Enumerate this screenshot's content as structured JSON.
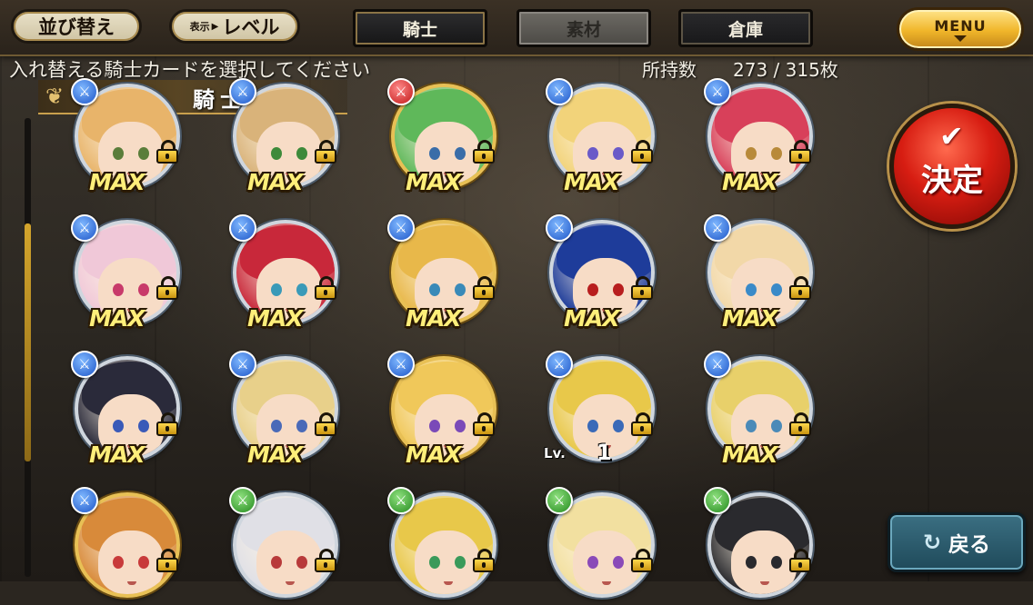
{
  "toolbar": {
    "sort_label": "並び替え",
    "display_prefix": "表示",
    "display_value": "レベル",
    "tabs": [
      {
        "label": "騎士",
        "state": "active"
      },
      {
        "label": "素材",
        "state": "inactive"
      },
      {
        "label": "倉庫",
        "state": "normal"
      }
    ],
    "menu_label": "MENU"
  },
  "instruction": "入れ替える騎士カードを選択してください",
  "owned": {
    "label": "所持数",
    "value": "273 / 315枚"
  },
  "section_title": "騎士",
  "cards": [
    {
      "attr": "blue",
      "label": "MAX",
      "hair": "#e8b46a",
      "eye": "#5a7d3a",
      "frame": "silver"
    },
    {
      "attr": "blue",
      "label": "MAX",
      "hair": "#d9b37a",
      "eye": "#3d8a3a",
      "frame": "silver"
    },
    {
      "attr": "red",
      "label": "MAX",
      "hair": "#5fb85a",
      "eye": "#3a6da8",
      "frame": "gold"
    },
    {
      "attr": "blue",
      "label": "MAX",
      "hair": "#f2d37a",
      "eye": "#6a5ac8",
      "frame": "silver"
    },
    {
      "attr": "blue",
      "label": "MAX",
      "hair": "#d8405a",
      "eye": "#b88a3a",
      "frame": "silver"
    },
    {
      "attr": "blue",
      "label": "MAX",
      "hair": "#f0c8d8",
      "eye": "#c83a6a",
      "frame": "silver"
    },
    {
      "attr": "blue",
      "label": "MAX",
      "hair": "#c8283a",
      "eye": "#3a9ab8",
      "frame": "silver"
    },
    {
      "attr": "blue",
      "label": "MAX",
      "hair": "#e8b84a",
      "eye": "#3a8ab8",
      "frame": "gold"
    },
    {
      "attr": "blue",
      "label": "MAX",
      "hair": "#1e3c9a",
      "eye": "#b81e1e",
      "frame": "silver"
    },
    {
      "attr": "blue",
      "label": "MAX",
      "hair": "#f2d8a8",
      "eye": "#3a8ac8",
      "frame": "silver"
    },
    {
      "attr": "blue",
      "label": "MAX",
      "hair": "#2a2a3a",
      "eye": "#3a5ab8",
      "frame": "silver"
    },
    {
      "attr": "blue",
      "label": "MAX",
      "hair": "#e8d08a",
      "eye": "#4a6ab8",
      "frame": "silver"
    },
    {
      "attr": "blue",
      "label": "MAX",
      "hair": "#f0c85a",
      "eye": "#7a4ab8",
      "frame": "gold"
    },
    {
      "attr": "blue",
      "label": "Lv. 1",
      "hair": "#e8c84a",
      "eye": "#3a6ab8",
      "frame": "silver",
      "level": "1"
    },
    {
      "attr": "blue",
      "label": "MAX",
      "hair": "#e8d06a",
      "eye": "#4a8ab8",
      "frame": "silver"
    },
    {
      "attr": "blue",
      "label": "",
      "hair": "#d88a3a",
      "eye": "#c83a3a",
      "frame": "gold"
    },
    {
      "attr": "green",
      "label": "",
      "hair": "#e0e0e6",
      "eye": "#b83a3a",
      "frame": "silver"
    },
    {
      "attr": "green",
      "label": "",
      "hair": "#e8c84a",
      "eye": "#3a9a5a",
      "frame": "silver"
    },
    {
      "attr": "green",
      "label": "",
      "hair": "#f2e0a0",
      "eye": "#8a4ab8",
      "frame": "silver"
    },
    {
      "attr": "green",
      "label": "",
      "hair": "#2a2a2e",
      "eye": "#2a2a2e",
      "frame": "silver"
    }
  ],
  "lv_prefix": "Lv.",
  "decide_label": "決定",
  "back_label": "戻る",
  "colors": {
    "accent_gold": "#c9a04d",
    "decide_red": "#d71d12",
    "back_teal": "#2f5f70"
  },
  "icons": {
    "attr_blue": "sword-icon",
    "attr_red": "sword-icon",
    "attr_green": "sword-icon",
    "lock": "lock-icon"
  }
}
